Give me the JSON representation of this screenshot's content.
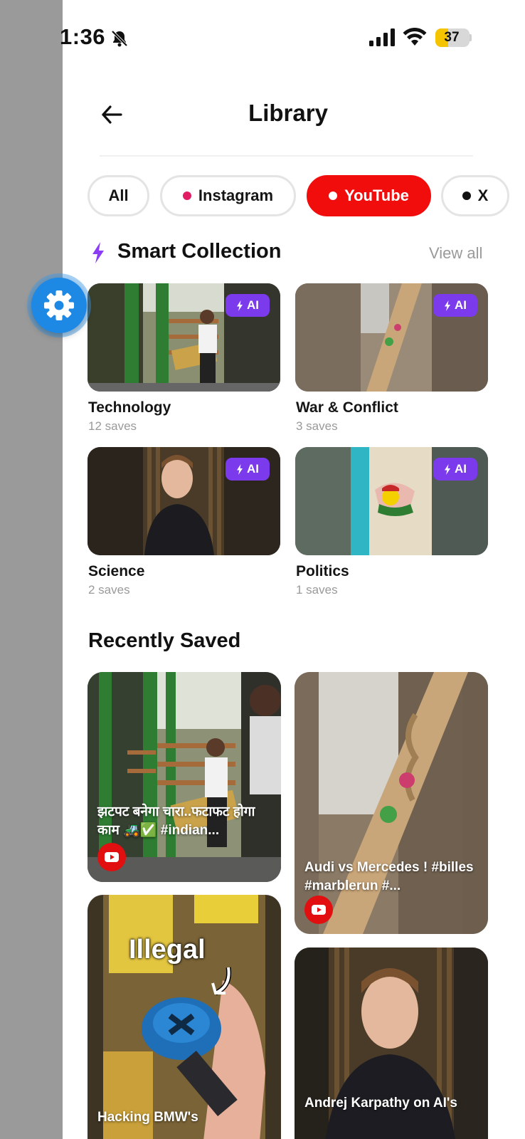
{
  "status_bar": {
    "time": "1:36",
    "battery_level": "37",
    "battery_fraction": 0.37
  },
  "header": {
    "title": "Library"
  },
  "filters": [
    {
      "label": "All",
      "dot_color": null,
      "active": false
    },
    {
      "label": "Instagram",
      "dot_color": "#e11d64",
      "active": false
    },
    {
      "label": "YouTube",
      "dot_color": "#ffffff",
      "active": true
    },
    {
      "label": "X",
      "dot_color": "#111111",
      "active": false
    }
  ],
  "smart_collection": {
    "heading": "Smart Collection",
    "view_all": "View all",
    "badge": "AI",
    "items": [
      {
        "title": "Technology",
        "count": "12 saves"
      },
      {
        "title": "War & Conflict",
        "count": "3 saves"
      },
      {
        "title": "Science",
        "count": "2 saves"
      },
      {
        "title": "Politics",
        "count": "1 saves"
      }
    ]
  },
  "recently_saved": {
    "heading": "Recently Saved",
    "items": [
      {
        "caption": "झटपट बनेगा चारा..फटाफट होगा काम 🚜✅ #indian...",
        "source": "youtube-icon"
      },
      {
        "caption": "Audi vs Mercedes ! #billes #marblerun #...",
        "source": "youtube-icon"
      },
      {
        "caption": "Illegal",
        "subcaption": "Hacking BMW's",
        "source": "youtube-icon"
      },
      {
        "caption": "Andrej Karpathy on AI's",
        "source": "youtube-icon"
      }
    ]
  },
  "colors": {
    "accent_red": "#f20d0d",
    "ai_purple": "#7c3aed",
    "fab_blue": "#1e88e5"
  }
}
